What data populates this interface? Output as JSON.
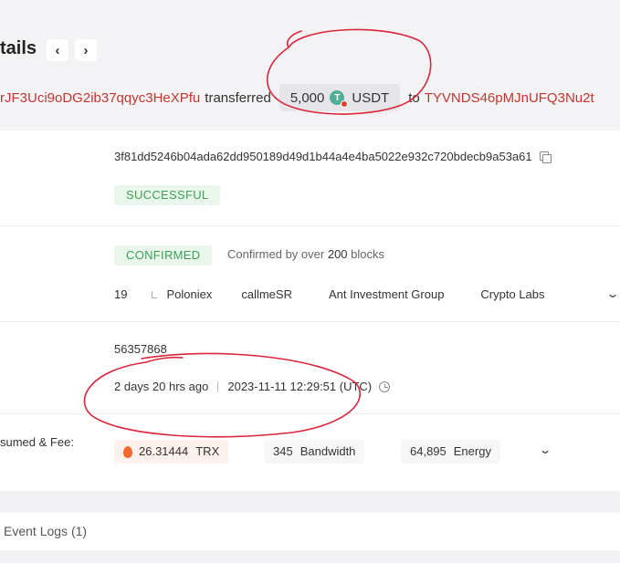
{
  "header": {
    "title": "tails",
    "prev_label": "‹",
    "next_label": "›"
  },
  "summary": {
    "from_address": "rJF3Uci9oDG2ib37qqyc3HeXPfu",
    "transferred_word": "transferred",
    "amount": "5,000",
    "token": "USDT",
    "to_word": "to",
    "to_address": "TYVNDS46pMJnUFQ3Nu2t"
  },
  "hash_row": {
    "hash": "3f81dd5246b04ada62dd950189d49d1b44a4e4ba5022e932c720bdecb9a53a61",
    "status": "SUCCESSFUL"
  },
  "confirm_row": {
    "status": "CONFIRMED",
    "text_prefix": "Confirmed by over",
    "blocks_count": "200",
    "text_suffix": "blocks",
    "sr_count": "19",
    "srs": [
      "Poloniex",
      "callmeSR",
      "Ant Investment Group",
      "Crypto Labs"
    ]
  },
  "block_row": {
    "block": "56357868",
    "relative_time": "2 days 20 hrs ago",
    "timestamp": "2023-11-11 12:29:51 (UTC)"
  },
  "fee_row": {
    "label": "sumed & Fee:",
    "trx_amount": "26.31444",
    "trx_unit": "TRX",
    "bandwidth_amount": "345",
    "bandwidth_unit": "Bandwidth",
    "energy_amount": "64,895",
    "energy_unit": "Energy"
  },
  "event_logs": {
    "label": "Event Logs (1)"
  },
  "colors": {
    "address": "#c23631",
    "success_text": "#3e9f57",
    "success_bg": "#e9f6ec",
    "annotation": "#d9263a",
    "usdt": "#50af95"
  },
  "icons": [
    "usdt-icon",
    "copy-icon",
    "chevron-down-icon",
    "clock-icon",
    "fire-icon"
  ]
}
